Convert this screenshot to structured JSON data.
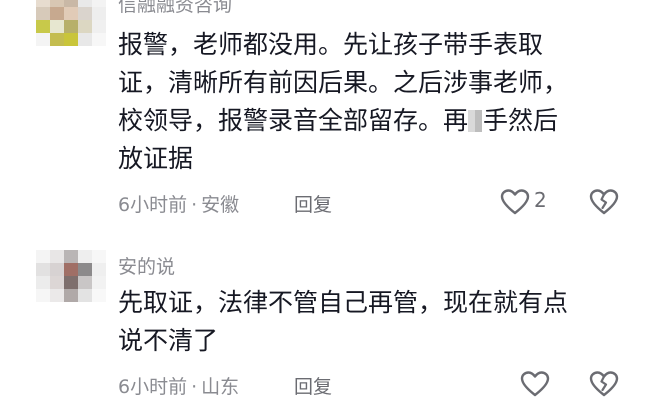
{
  "colors": {
    "text_primary": "#161823",
    "text_secondary": "#8a8b91",
    "icon": "#6b6c72"
  },
  "comments": [
    {
      "username": "信融融资咨询",
      "lines": [
        "报警，老师都没用。先让孩子带手表取",
        "证，清晰所有前因后果。之后涉事老师，",
        "校领导，报警录音全部留存。再",
        "放证据"
      ],
      "line3_after_mosaic": "手然后",
      "time": "6小时前",
      "separator": "·",
      "location": "安徽",
      "reply_label": "回复",
      "like_icon": "heart-outline-icon",
      "like_count": "2",
      "dislike_icon": "broken-heart-icon"
    },
    {
      "username": "安的说",
      "lines": [
        "先取证，法律不管自己再管，现在就有点",
        "说不清了"
      ],
      "time": "6小时前",
      "separator": "·",
      "location": "山东",
      "reply_label": "回复",
      "like_icon": "heart-outline-icon",
      "dislike_icon": "broken-heart-icon"
    }
  ]
}
